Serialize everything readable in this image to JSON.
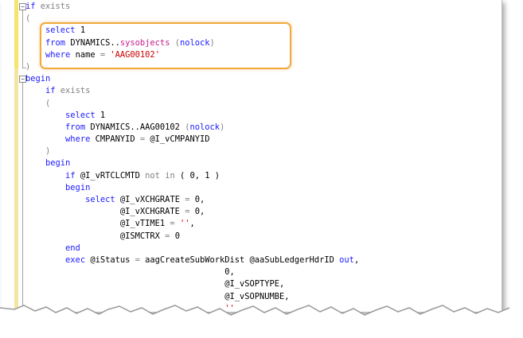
{
  "editor": {
    "lines": [
      {
        "indent": "",
        "tokens": [
          {
            "t": "if",
            "c": "kw"
          },
          {
            "t": " exists",
            "c": "gr"
          }
        ]
      },
      {
        "indent": "",
        "tokens": [
          {
            "t": "(",
            "c": "gr"
          }
        ]
      },
      {
        "indent": "    ",
        "tokens": [
          {
            "t": "select",
            "c": "kw"
          },
          {
            "t": " 1",
            "c": "tx"
          }
        ]
      },
      {
        "indent": "    ",
        "tokens": [
          {
            "t": "from",
            "c": "kw"
          },
          {
            "t": " DYNAMICS..",
            "c": "tx"
          },
          {
            "t": "sysobjects",
            "c": "pk"
          },
          {
            "t": " (",
            "c": "gr"
          },
          {
            "t": "nolock",
            "c": "kw"
          },
          {
            "t": ")",
            "c": "gr"
          }
        ]
      },
      {
        "indent": "    ",
        "tokens": [
          {
            "t": "where",
            "c": "kw"
          },
          {
            "t": " name ",
            "c": "tx"
          },
          {
            "t": "=",
            "c": "gr"
          },
          {
            "t": " ",
            "c": "tx"
          },
          {
            "t": "'AAG00102'",
            "c": "str"
          }
        ]
      },
      {
        "indent": "",
        "tokens": [
          {
            "t": ")",
            "c": "gr"
          }
        ]
      },
      {
        "indent": "",
        "tokens": [
          {
            "t": "begin",
            "c": "kw"
          }
        ]
      },
      {
        "indent": "    ",
        "tokens": [
          {
            "t": "if",
            "c": "kw"
          },
          {
            "t": " exists",
            "c": "gr"
          }
        ]
      },
      {
        "indent": "    ",
        "tokens": [
          {
            "t": "(",
            "c": "gr"
          }
        ]
      },
      {
        "indent": "        ",
        "tokens": [
          {
            "t": "select",
            "c": "kw"
          },
          {
            "t": " 1",
            "c": "tx"
          }
        ]
      },
      {
        "indent": "        ",
        "tokens": [
          {
            "t": "from",
            "c": "kw"
          },
          {
            "t": " DYNAMICS..AAG00102 ",
            "c": "tx"
          },
          {
            "t": "(",
            "c": "gr"
          },
          {
            "t": "nolock",
            "c": "kw"
          },
          {
            "t": ")",
            "c": "gr"
          }
        ]
      },
      {
        "indent": "        ",
        "tokens": [
          {
            "t": "where",
            "c": "kw"
          },
          {
            "t": " CMPANYID ",
            "c": "tx"
          },
          {
            "t": "=",
            "c": "gr"
          },
          {
            "t": " @I_vCMPANYID",
            "c": "tx"
          }
        ]
      },
      {
        "indent": "    ",
        "tokens": [
          {
            "t": ")",
            "c": "gr"
          }
        ]
      },
      {
        "indent": "    ",
        "tokens": [
          {
            "t": "begin",
            "c": "kw"
          }
        ]
      },
      {
        "indent": "        ",
        "tokens": [
          {
            "t": "if",
            "c": "kw"
          },
          {
            "t": " @I_vRTCLCMTD ",
            "c": "tx"
          },
          {
            "t": "not",
            "c": "gr"
          },
          {
            "t": " ",
            "c": "tx"
          },
          {
            "t": "in",
            "c": "gr"
          },
          {
            "t": " ( 0, 1 )",
            "c": "tx"
          }
        ]
      },
      {
        "indent": "        ",
        "tokens": [
          {
            "t": "begin",
            "c": "kw"
          }
        ]
      },
      {
        "indent": "            ",
        "tokens": [
          {
            "t": "select",
            "c": "kw"
          },
          {
            "t": " @I_vXCHGRATE ",
            "c": "tx"
          },
          {
            "t": "=",
            "c": "gr"
          },
          {
            "t": " 0,",
            "c": "tx"
          }
        ]
      },
      {
        "indent": "                   ",
        "tokens": [
          {
            "t": "@I_vXCHGRATE ",
            "c": "tx"
          },
          {
            "t": "=",
            "c": "gr"
          },
          {
            "t": " 0,",
            "c": "tx"
          }
        ]
      },
      {
        "indent": "                   ",
        "tokens": [
          {
            "t": "@I_vTIME1 ",
            "c": "tx"
          },
          {
            "t": "=",
            "c": "gr"
          },
          {
            "t": " ",
            "c": "tx"
          },
          {
            "t": "''",
            "c": "str"
          },
          {
            "t": ",",
            "c": "tx"
          }
        ]
      },
      {
        "indent": "                   ",
        "tokens": [
          {
            "t": "@ISMCTRX ",
            "c": "tx"
          },
          {
            "t": "=",
            "c": "gr"
          },
          {
            "t": " 0",
            "c": "tx"
          }
        ]
      },
      {
        "indent": "        ",
        "tokens": [
          {
            "t": "end",
            "c": "kw"
          }
        ]
      },
      {
        "indent": "        ",
        "tokens": [
          {
            "t": "exec",
            "c": "kw"
          },
          {
            "t": " @iStatus ",
            "c": "tx"
          },
          {
            "t": "=",
            "c": "gr"
          },
          {
            "t": " aagCreateSubWorkDist ",
            "c": "tx"
          },
          {
            "t": "@aaSubLedgerHdrID ",
            "c": "tx"
          },
          {
            "t": "out",
            "c": "kw"
          },
          {
            "t": ",",
            "c": "tx"
          }
        ]
      },
      {
        "indent": "                                        ",
        "tokens": [
          {
            "t": "0,",
            "c": "tx"
          }
        ]
      },
      {
        "indent": "                                        ",
        "tokens": [
          {
            "t": "@I_vSOPTYPE,",
            "c": "tx"
          }
        ]
      },
      {
        "indent": "                                        ",
        "tokens": [
          {
            "t": "@I_vSOPNUMBE,",
            "c": "tx"
          }
        ]
      },
      {
        "indent": "                                        ",
        "tokens": [
          {
            "t": "''",
            "c": "str"
          }
        ]
      }
    ]
  },
  "colors": {
    "keyword": "#1a1aff",
    "operator": "#808080",
    "string": "#cc0000",
    "system_object": "#c61a8a",
    "highlight_border": "#f0a93a"
  },
  "icons": [
    "collapse-icon"
  ]
}
